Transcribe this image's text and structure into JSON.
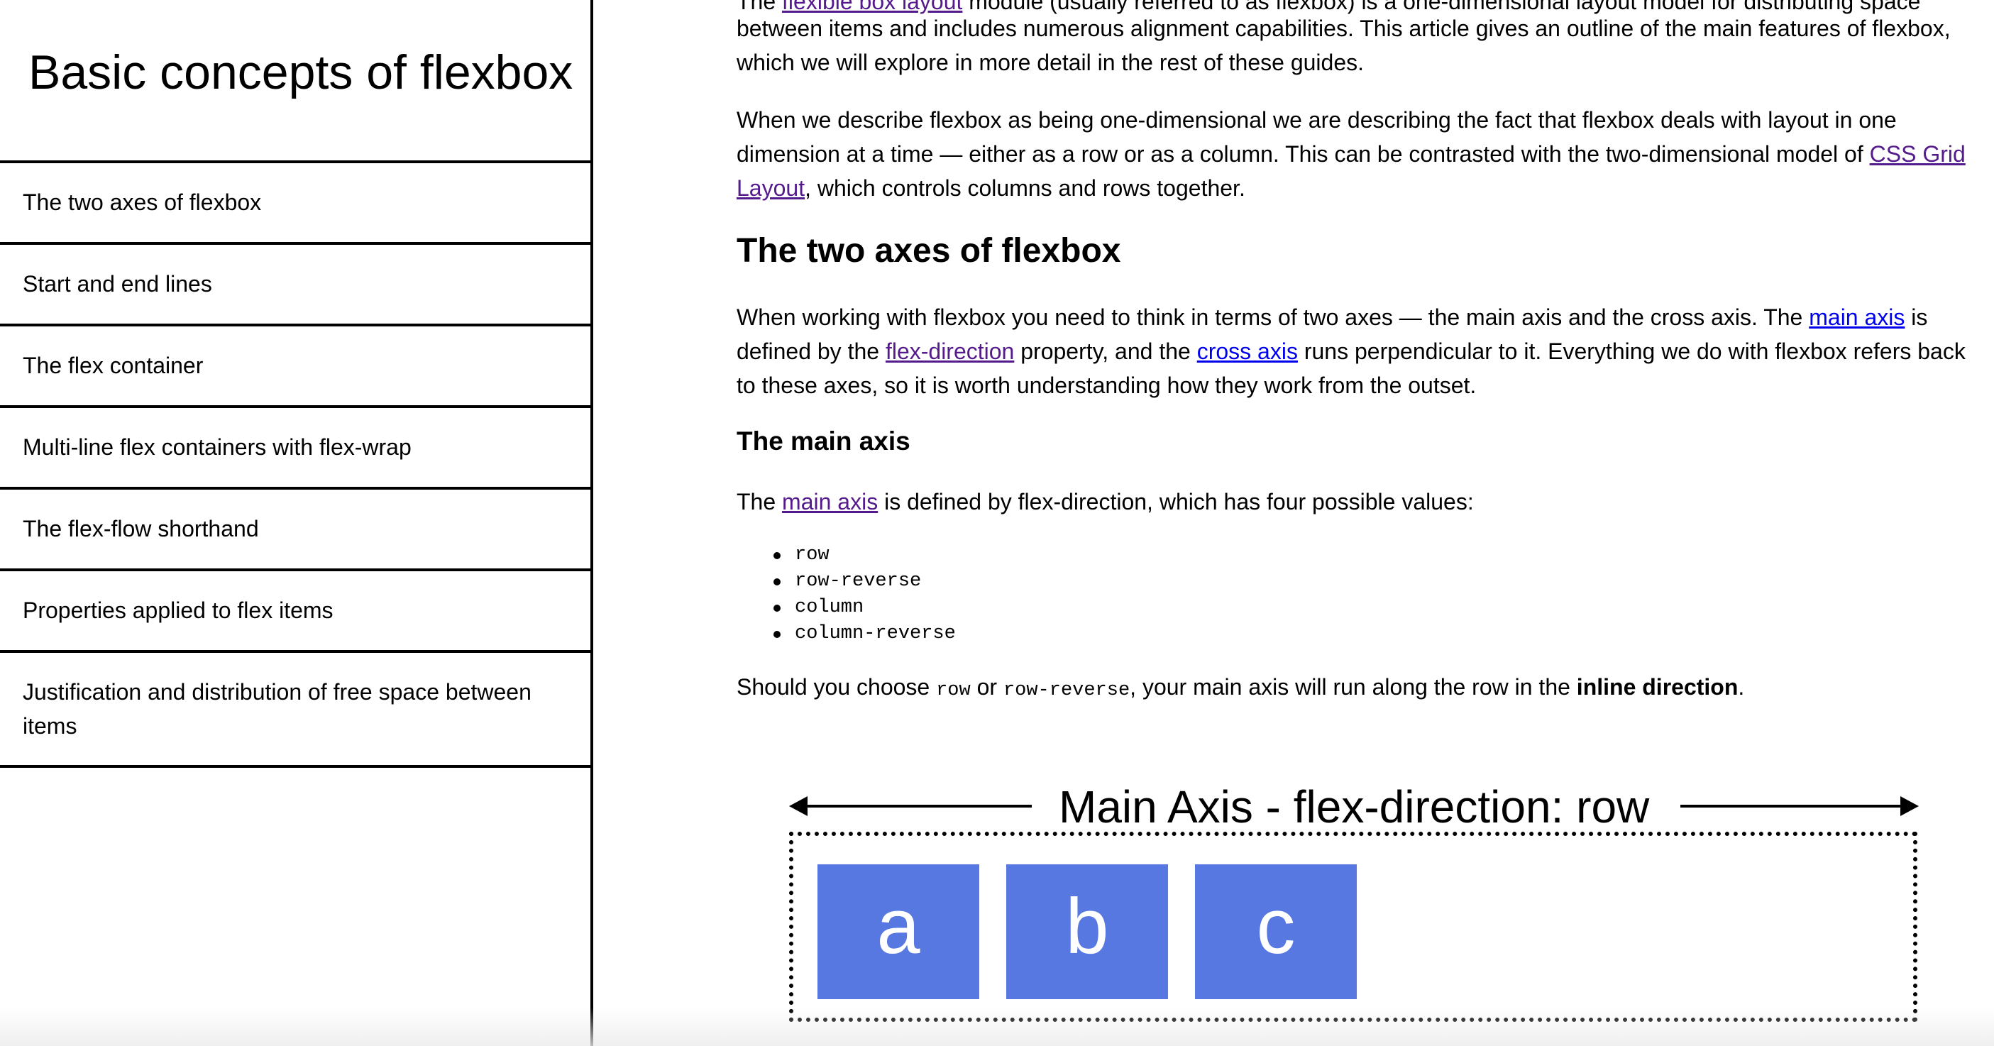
{
  "sidebar": {
    "title": "Basic concepts of flexbox",
    "items": [
      {
        "label": "The two axes of flexbox"
      },
      {
        "label": "Start and end lines"
      },
      {
        "label": "The flex container"
      },
      {
        "label": "Multi-line flex containers with flex-wrap"
      },
      {
        "label": "The flex-flow shorthand"
      },
      {
        "label": "Properties applied to flex items"
      },
      {
        "label": "Justification and distribution of free space between items"
      }
    ]
  },
  "article": {
    "intro_cut": {
      "before": "The ",
      "link": "flexible box layout",
      "after": " module (usually referred to as flexbox) is a one-dimensional layout model for distributing space"
    },
    "intro_line2": "between items and includes numerous alignment capabilities. This article gives an outline of the main features of flexbox,",
    "intro_line3": "which we will explore in more detail in the rest of these guides.",
    "p2_line1": "When we describe flexbox as being one-dimensional we are describing the fact that flexbox deals with layout in one",
    "p2_line2_before": "dimension at a time — either as a row or as a column. This can be contrasted with the two-dimensional model of ",
    "p2_link_part1": "CSS Grid",
    "p2_link_part2": "Layout",
    "p2_line3_after": ", which controls columns and rows together.",
    "h2_axes": "The two axes of flexbox",
    "p3_line1_before": "When working with flexbox you need to think in terms of two axes — the main axis and the cross axis. The ",
    "p3_link_main_axis": "main axis",
    "p3_line1_after": " is",
    "p3_line2_before": "defined by the ",
    "p3_link_flex_direction": "flex-direction",
    "p3_line2_mid": " property, and the ",
    "p3_link_cross_axis": "cross axis",
    "p3_line2_after": " runs perpendicular to it. Everything we do with flexbox refers back",
    "p3_line3": "to these axes, so it is worth understanding how they work from the outset.",
    "h3_main_axis": "The main axis",
    "p4_before": "The ",
    "p4_link": "main axis",
    "p4_after": " is defined by flex-direction, which has four possible values:",
    "values": [
      "row",
      "row-reverse",
      "column",
      "column-reverse"
    ],
    "p5_before": "Should you choose ",
    "p5_code1": "row",
    "p5_or": " or ",
    "p5_code2": "row-reverse",
    "p5_mid": ", your main axis will run along the row in the ",
    "p5_bold": "inline direction",
    "p5_end": "."
  },
  "diagram": {
    "label": "Main Axis - flex-direction: row",
    "items": [
      "a",
      "b",
      "c"
    ],
    "item_color": "#5778e0"
  },
  "colors": {
    "link": "#0000ee",
    "link_visited": "#551a8b"
  }
}
